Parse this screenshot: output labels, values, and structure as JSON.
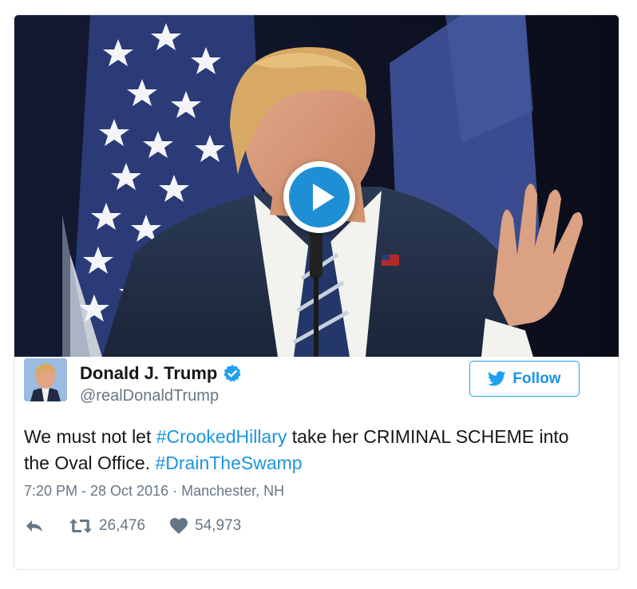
{
  "video": {
    "play_icon": "play-icon"
  },
  "author": {
    "name": "Donald J. Trump",
    "handle": "@realDonaldTrump",
    "verified_icon": "verified-badge-icon"
  },
  "follow_button": {
    "label": "Follow",
    "icon": "twitter-bird-icon"
  },
  "tweet": {
    "part1": "We must not let ",
    "hashtag1": "#CrookedHillary",
    "part2": " take her CRIMINAL SCHEME into the Oval Office. ",
    "hashtag2": "#DrainTheSwamp"
  },
  "meta": {
    "timestamp": "7:20 PM - 28 Oct 2016",
    "separator": " · ",
    "location": "Manchester, NH"
  },
  "actions": {
    "reply_icon": "reply-icon",
    "retweet_icon": "retweet-icon",
    "retweet_count": "26,476",
    "like_icon": "heart-icon",
    "like_count": "54,973"
  },
  "colors": {
    "accent": "#1b95e0",
    "text": "#14171a",
    "secondary": "#657786",
    "border": "#e1e8ed"
  }
}
